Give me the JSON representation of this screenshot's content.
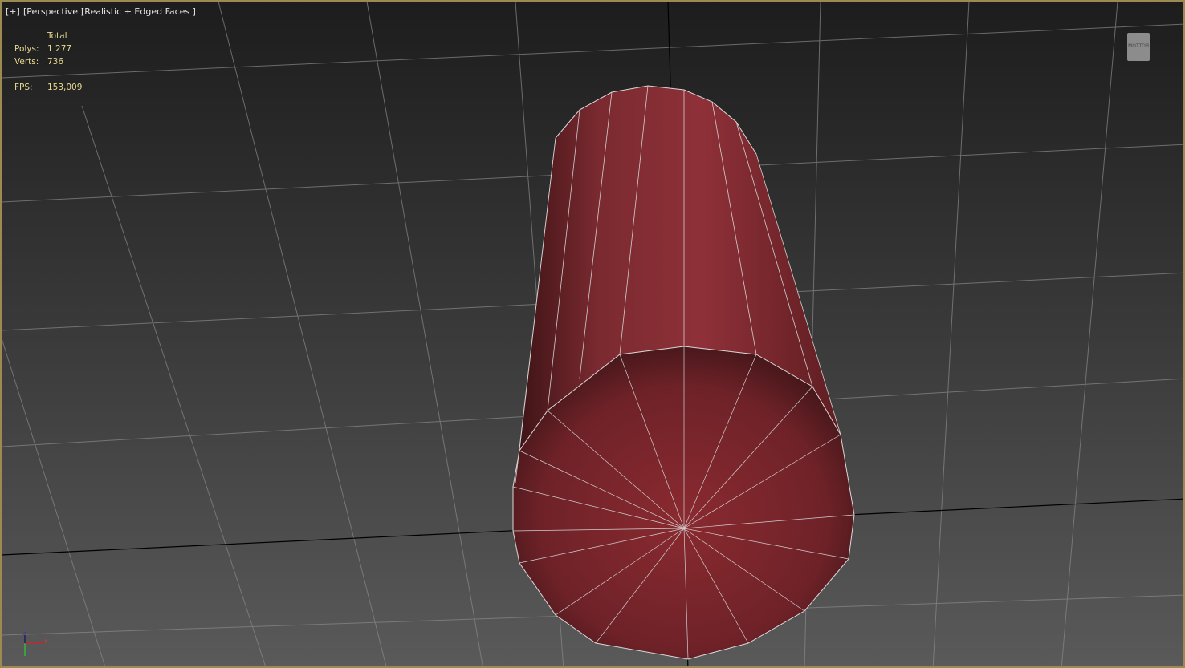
{
  "viewport": {
    "menu_label": "[+]",
    "view_label": "[Perspective ]",
    "shading_label": "[Realistic + Edged Faces ]"
  },
  "stats": {
    "header": "Total",
    "polys_label": "Polys:",
    "polys_value": "1 277",
    "verts_label": "Verts:",
    "verts_value": "736",
    "fps_label": "FPS:",
    "fps_value": "153,009"
  },
  "viewcube": {
    "face": "BOTTOM"
  },
  "gizmo": {
    "z": "z",
    "x": "x"
  },
  "colors": {
    "border": "#9c8a52",
    "stats_text": "#e8d890",
    "object": "#8a2a30"
  }
}
